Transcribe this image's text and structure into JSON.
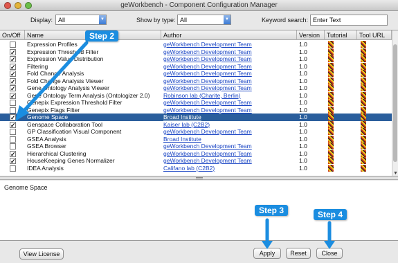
{
  "window": {
    "title": "geWorkbench - Component Configuration Manager"
  },
  "filters": {
    "display_label": "Display:",
    "display_value": "All",
    "type_label": "Show by type:",
    "type_value": "All",
    "keyword_label": "Keyword search:",
    "keyword_value": "Enter Text"
  },
  "table": {
    "headers": [
      "On/Off",
      "Name",
      "Author",
      "Version",
      "Tutorial",
      "Tool URL"
    ],
    "rows": [
      {
        "checked": false,
        "name": "Expression Profiles",
        "author": "geWorkbench Development Team",
        "version": "1.0"
      },
      {
        "checked": true,
        "name": "Expression Threshold Filter",
        "author": "geWorkbench Development Team",
        "version": "1.0"
      },
      {
        "checked": true,
        "name": "Expression Value Distribution",
        "author": "geWorkbench Development Team",
        "version": "1.0"
      },
      {
        "checked": true,
        "name": "Filtering",
        "author": "geWorkbench Development Team",
        "version": "1.0"
      },
      {
        "checked": true,
        "name": "Fold Change Analysis",
        "author": "geWorkbench Development Team",
        "version": "1.0"
      },
      {
        "checked": true,
        "name": "Fold Change Analysis Viewer",
        "author": "geWorkbench Development Team",
        "version": "1.0"
      },
      {
        "checked": true,
        "name": "Gene Ontology Analysis Viewer",
        "author": "geWorkbench Development Team",
        "version": "1.0"
      },
      {
        "checked": true,
        "name": "Gene Ontology Term Analysis (Ontologizer 2.0)",
        "author": "Robinson lab (Charite, Berlin)",
        "version": "1.0"
      },
      {
        "checked": false,
        "name": "Genepix Expression Threshold Filter",
        "author": "geWorkbench Development Team",
        "version": "1.0"
      },
      {
        "checked": false,
        "name": "Genepix Flags Filter",
        "author": "geWorkbench Development Team",
        "version": "1.0"
      },
      {
        "checked": true,
        "name": "Genome Space",
        "author": "Broad Institute",
        "version": "1.0",
        "selected": true
      },
      {
        "checked": true,
        "name": "Genspace Collaboration Tool",
        "author": "Kaiser lab (C2B2)",
        "version": "1.0"
      },
      {
        "checked": false,
        "name": "GP Classification Visual Component",
        "author": "geWorkbench Development Team",
        "version": "1.0"
      },
      {
        "checked": false,
        "name": "GSEA Analysis",
        "author": "Broad Institute",
        "version": "1.0"
      },
      {
        "checked": false,
        "name": "GSEA Browser",
        "author": "geWorkbench Development Team",
        "version": "1.0"
      },
      {
        "checked": true,
        "name": "Hierarchical Clustering",
        "author": "geWorkbench Development Team",
        "version": "1.0"
      },
      {
        "checked": true,
        "name": "HouseKeeping Genes Normalizer",
        "author": "geWorkbench Development Team",
        "version": "1.0"
      },
      {
        "checked": false,
        "name": "IDEA Analysis",
        "author": "Califano lab (C2B2)",
        "version": "1.0"
      }
    ]
  },
  "description": {
    "text": "Genome Space"
  },
  "buttons": {
    "view_license": "View License",
    "apply": "Apply",
    "reset": "Reset",
    "close": "Close"
  },
  "callouts": {
    "step2": "Step 2",
    "step3": "Step 3",
    "step4": "Step 4"
  },
  "colors": {
    "selection": "#2a5e9c",
    "callout": "#1b8de0",
    "link": "#1a45c4"
  }
}
